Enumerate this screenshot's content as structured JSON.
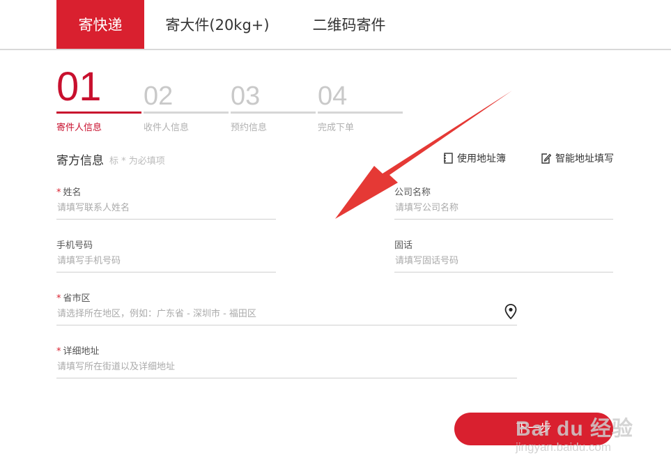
{
  "tabs": [
    {
      "label": "寄快递",
      "active": true
    },
    {
      "label": "寄大件(20kg+)",
      "active": false
    },
    {
      "label": "二维码寄件",
      "active": false
    }
  ],
  "steps": [
    {
      "num": "01",
      "label": "寄件人信息",
      "active": true
    },
    {
      "num": "02",
      "label": "收件人信息",
      "active": false
    },
    {
      "num": "03",
      "label": "预约信息",
      "active": false
    },
    {
      "num": "04",
      "label": "完成下单",
      "active": false
    }
  ],
  "section": {
    "title": "寄方信息",
    "note": "标 * 为必填项",
    "address_book": "使用地址簿",
    "smart_fill": "智能地址填写"
  },
  "form": {
    "name": {
      "required": "*",
      "label": "姓名",
      "placeholder": "请填写联系人姓名"
    },
    "company": {
      "label": "公司名称",
      "placeholder": "请填写公司名称"
    },
    "mobile": {
      "label": "手机号码",
      "placeholder": "请填写手机号码"
    },
    "landline": {
      "label": "固话",
      "placeholder": "请填写固话号码"
    },
    "region": {
      "required": "*",
      "label": "省市区",
      "placeholder": "请选择所在地区，例如：广东省 - 深圳市 - 福田区",
      "icon": "location-pin-icon"
    },
    "address": {
      "required": "*",
      "label": "详细地址",
      "placeholder": "请填写所在街道以及详细地址"
    }
  },
  "next_button": {
    "label": "下一步"
  },
  "watermark": {
    "logo": "Bai du 经验",
    "url": "jingyan.baidu.com"
  },
  "colors": {
    "accent": "#d9202f",
    "annotation_arrow": "#e53935"
  }
}
